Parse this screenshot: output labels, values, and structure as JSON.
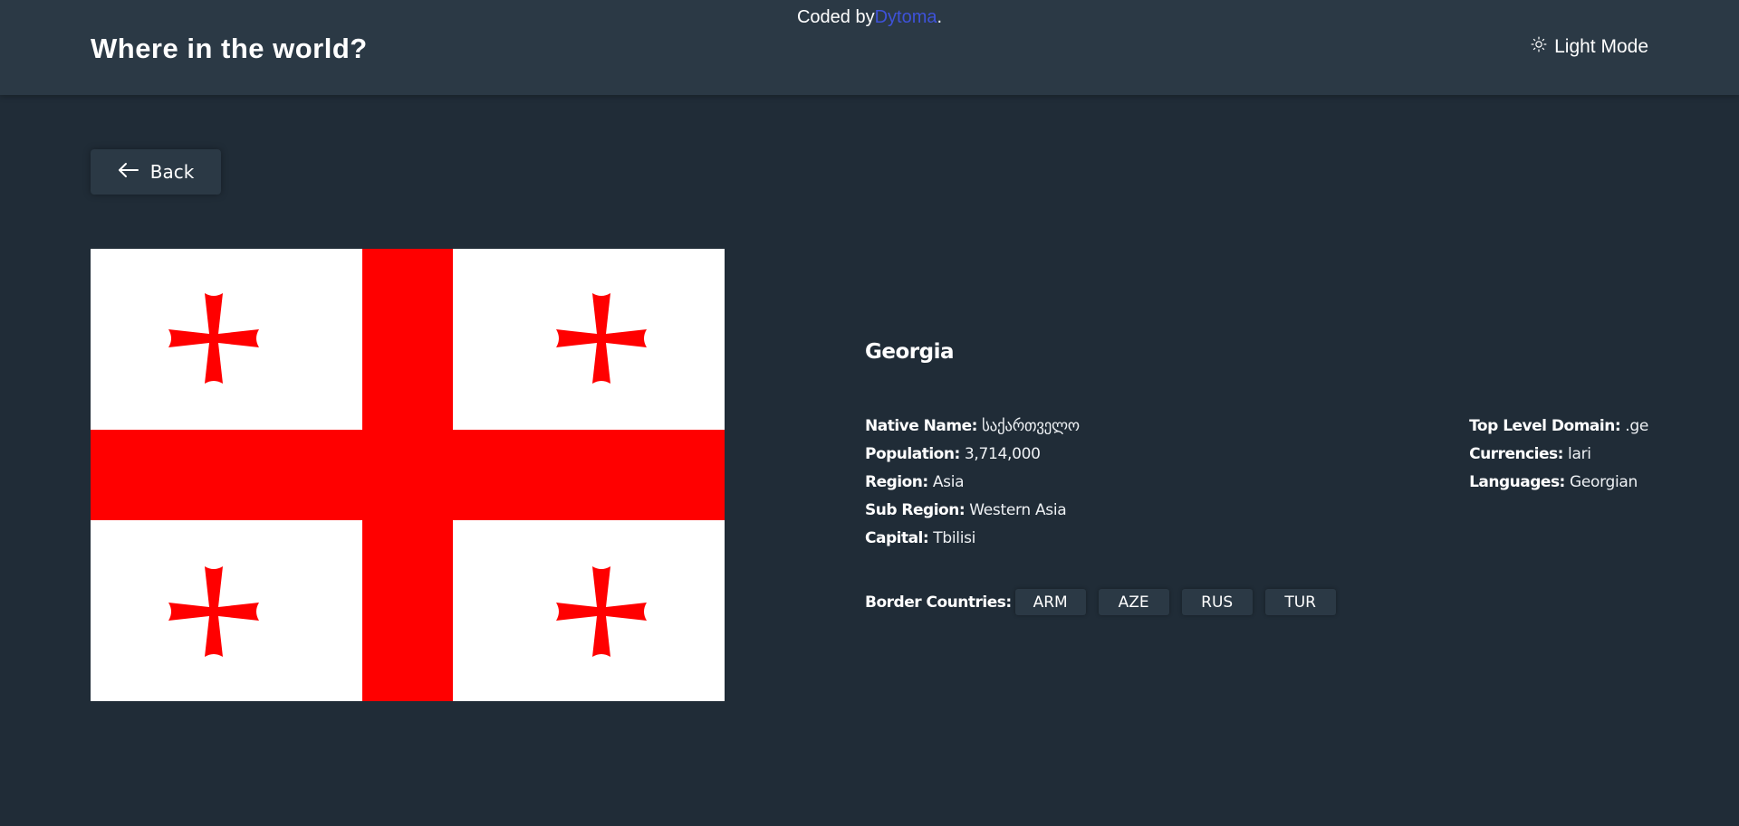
{
  "attribution": {
    "prefix": "Coded by",
    "author": "Dytoma",
    "suffix": "."
  },
  "header": {
    "title": "Where in the world?",
    "mode_toggle_label": "Light Mode",
    "mode_icon": "sun-icon"
  },
  "back_button": {
    "label": "Back",
    "icon": "arrow-left-icon"
  },
  "country": {
    "name": "Georgia",
    "flag": {
      "description_icon": "flag-georgia",
      "colors": {
        "field": "#ffffff",
        "cross": "#ff0000"
      }
    },
    "fields_left": [
      {
        "label": "Native Name:",
        "value": "საქართველო"
      },
      {
        "label": "Population:",
        "value": "3,714,000"
      },
      {
        "label": "Region:",
        "value": "Asia"
      },
      {
        "label": "Sub Region:",
        "value": "Western Asia"
      },
      {
        "label": "Capital:",
        "value": "Tbilisi"
      }
    ],
    "fields_right": [
      {
        "label": "Top Level Domain:",
        "value": ".ge"
      },
      {
        "label": "Currencies:",
        "value": "lari"
      },
      {
        "label": "Languages:",
        "value": "Georgian"
      }
    ],
    "border_label": "Border Countries:",
    "borders": [
      "ARM",
      "AZE",
      "RUS",
      "TUR"
    ]
  },
  "colors": {
    "background": "#202c37",
    "elements": "#2b3945",
    "text": "#ffffff",
    "link": "#3e52d9"
  }
}
